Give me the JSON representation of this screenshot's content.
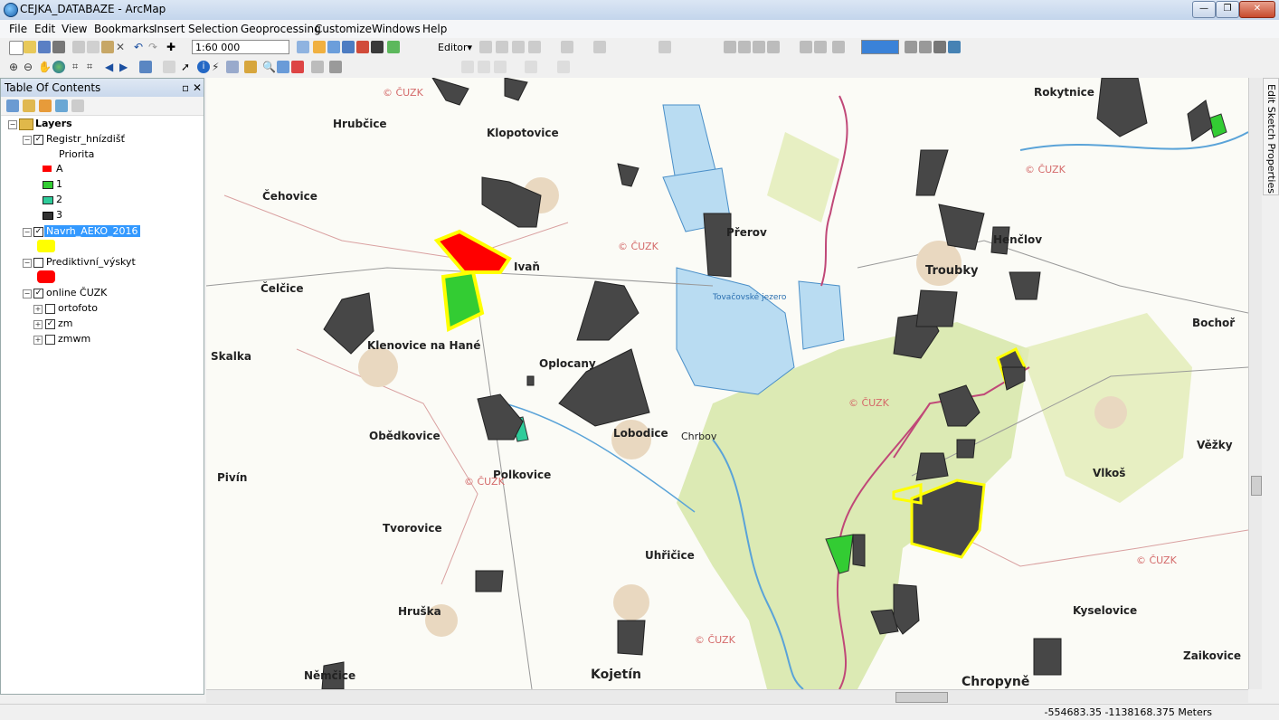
{
  "window": {
    "title": "CEJKA_DATABAZE - ArcMap"
  },
  "menu": [
    "File",
    "Edit",
    "View",
    "Bookmarks",
    "Insert",
    "Selection",
    "Geoprocessing",
    "Customize",
    "Windows",
    "Help"
  ],
  "toolbar": {
    "scale": "1:60 000",
    "editor_label": "Editor▾"
  },
  "toc": {
    "title": "Table Of Contents",
    "root": "Layers",
    "layers": [
      {
        "name": "Registr_hnízdišť",
        "checked": true,
        "subtitle": "Priorita",
        "legend": [
          {
            "label": "A",
            "color": "#ff0000"
          },
          {
            "label": "1",
            "color": "#33cc33"
          },
          {
            "label": "2",
            "color": "#2ecc9a"
          },
          {
            "label": "3",
            "color": "#333333"
          }
        ]
      },
      {
        "name": "Navrh_AEKO_2016",
        "checked": true,
        "color": "#ffff00"
      },
      {
        "name": "Prediktivní_výskyt",
        "checked": false,
        "color": "#ff0000"
      },
      {
        "name": "online ČUZK",
        "checked": true,
        "children": [
          {
            "name": "ortofoto",
            "checked": false
          },
          {
            "name": "zm",
            "checked": true
          },
          {
            "name": "zmwm",
            "checked": false
          }
        ]
      }
    ]
  },
  "map": {
    "towns": [
      "Hrubčice",
      "Klopotovice",
      "Čehovice",
      "Ivaň",
      "Čelčice",
      "Klenovice na Hané",
      "Skalka",
      "Oplocany",
      "Obědkovice",
      "Pivín",
      "Polkovice",
      "Tvorovice",
      "Hruška",
      "Lobodice",
      "Uhřičice",
      "Kojetín",
      "Troubky",
      "Rokytnice",
      "Bochoř",
      "Vlkoš",
      "Kyselovice",
      "Zaikovice",
      "Chropyně",
      "Věžky",
      "Henčlov",
      "Přerov",
      "Tovačovské jezero",
      "Chrbov",
      "Němčice"
    ],
    "watermark": "© ČUZK"
  },
  "status": {
    "coords": "-554683.35  -1138168.375 Meters"
  },
  "right_panel": {
    "label": "Edit Sketch Properties"
  }
}
